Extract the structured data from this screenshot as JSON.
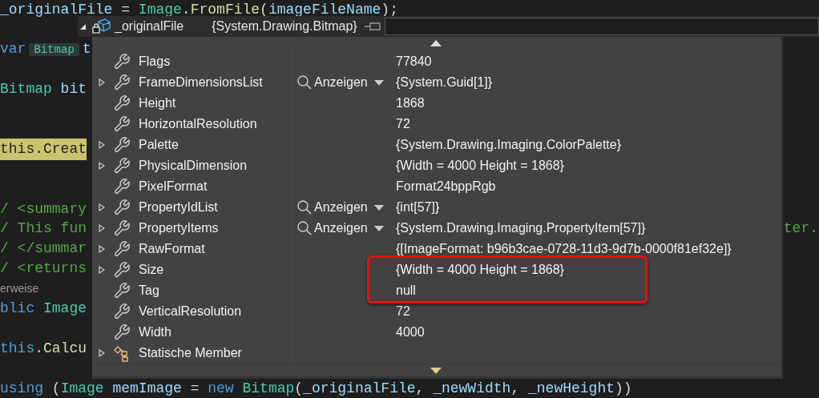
{
  "code_lines": [
    {
      "kind": "code",
      "tokens": [
        {
          "kind": "variable",
          "text": "_originalFile"
        },
        {
          "kind": "plain",
          "text": " = "
        },
        {
          "kind": "type",
          "text": "Image"
        },
        {
          "kind": "plain",
          "text": "."
        },
        {
          "kind": "method",
          "text": "FromFile"
        },
        {
          "kind": "plain",
          "text": "("
        },
        {
          "kind": "variable",
          "text": "imageFileName"
        },
        {
          "kind": "plain",
          "text": ");"
        }
      ]
    },
    {
      "kind": "code",
      "tokens": [
        {
          "kind": "keyword",
          "text": "var"
        },
        {
          "kind": "hint",
          "text": "Bitmap"
        },
        {
          "kind": "variable",
          "text": "t"
        }
      ]
    },
    {
      "kind": "code",
      "tokens": [
        {
          "kind": "type",
          "text": "Bitmap"
        },
        {
          "kind": "variable",
          "text": " bit"
        }
      ]
    },
    {
      "kind": "current",
      "tokens": [
        {
          "kind": "plain",
          "text": "this.Creat"
        }
      ]
    },
    {
      "kind": "code",
      "tokens": [
        {
          "kind": "comment",
          "text": "/ <summary"
        }
      ]
    },
    {
      "kind": "code",
      "tokens": [
        {
          "kind": "comment",
          "text": "/ This fun"
        }
      ],
      "right_fragment": "ter."
    },
    {
      "kind": "code",
      "tokens": [
        {
          "kind": "comment",
          "text": "/ </summar"
        }
      ]
    },
    {
      "kind": "code",
      "tokens": [
        {
          "kind": "comment",
          "text": "/ <returns"
        }
      ]
    },
    {
      "kind": "codelens",
      "tokens": [
        {
          "kind": "plain",
          "text": "erweise"
        }
      ]
    },
    {
      "kind": "code",
      "tokens": [
        {
          "kind": "keyword",
          "text": "blic"
        },
        {
          "kind": "type",
          "text": " Image"
        }
      ]
    },
    {
      "kind": "code",
      "tokens": [
        {
          "kind": "keyword",
          "text": "this"
        },
        {
          "kind": "plain",
          "text": "."
        },
        {
          "kind": "method",
          "text": "Calcu"
        }
      ]
    },
    {
      "kind": "code",
      "tokens": [
        {
          "kind": "keyword",
          "text": "using"
        },
        {
          "kind": "plain",
          "text": " ("
        },
        {
          "kind": "type",
          "text": "Image"
        },
        {
          "kind": "variable",
          "text": " memImage"
        },
        {
          "kind": "plain",
          "text": " = "
        },
        {
          "kind": "keyword",
          "text": "new"
        },
        {
          "kind": "type",
          "text": " Bitmap"
        },
        {
          "kind": "plain",
          "text": "("
        },
        {
          "kind": "variable",
          "text": "_originalFile"
        },
        {
          "kind": "plain",
          "text": ", "
        },
        {
          "kind": "variable",
          "text": "_newWidth"
        },
        {
          "kind": "plain",
          "text": ", "
        },
        {
          "kind": "variable",
          "text": "_newHeight"
        },
        {
          "kind": "plain",
          "text": "))"
        }
      ]
    }
  ],
  "datatip": {
    "expanded": true,
    "name": "_originalFile",
    "value": "{System.Drawing.Bitmap}",
    "properties": [
      {
        "kind": "property",
        "name": "Flags",
        "expandable": false,
        "value": "77840",
        "highlighted": false
      },
      {
        "kind": "property",
        "name": "FrameDimensionsList",
        "expandable": true,
        "visualizer": "Anzeigen",
        "value": "{System.Guid[1]}",
        "highlighted": false
      },
      {
        "kind": "property",
        "name": "Height",
        "expandable": false,
        "value": "1868",
        "highlighted": false
      },
      {
        "kind": "property",
        "name": "HorizontalResolution",
        "expandable": false,
        "value": "72",
        "highlighted": false
      },
      {
        "kind": "property",
        "name": "Palette",
        "expandable": true,
        "value": "{System.Drawing.Imaging.ColorPalette}",
        "highlighted": false
      },
      {
        "kind": "property",
        "name": "PhysicalDimension",
        "expandable": true,
        "value": "{Width = 4000 Height = 1868}",
        "highlighted": false
      },
      {
        "kind": "property",
        "name": "PixelFormat",
        "expandable": false,
        "value": "Format24bppRgb",
        "highlighted": false
      },
      {
        "kind": "property",
        "name": "PropertyIdList",
        "expandable": true,
        "visualizer": "Anzeigen",
        "value": "{int[57]}",
        "highlighted": false
      },
      {
        "kind": "property",
        "name": "PropertyItems",
        "expandable": true,
        "visualizer": "Anzeigen",
        "value": "{System.Drawing.Imaging.PropertyItem[57]}",
        "highlighted": false
      },
      {
        "kind": "property",
        "name": "RawFormat",
        "expandable": true,
        "value": "{[ImageFormat: b96b3cae-0728-11d3-9d7b-0000f81ef32e]}",
        "highlighted": false
      },
      {
        "kind": "property",
        "name": "Size",
        "expandable": true,
        "value": "{Width = 4000 Height = 1868}",
        "highlighted": true
      },
      {
        "kind": "property",
        "name": "Tag",
        "expandable": false,
        "value": "null",
        "highlighted": true
      },
      {
        "kind": "property",
        "name": "VerticalResolution",
        "expandable": false,
        "value": "72",
        "highlighted": false
      },
      {
        "kind": "property",
        "name": "Width",
        "expandable": false,
        "value": "4000",
        "highlighted": false
      },
      {
        "kind": "static",
        "name": "Statische Member",
        "expandable": true,
        "highlighted": false
      }
    ]
  }
}
